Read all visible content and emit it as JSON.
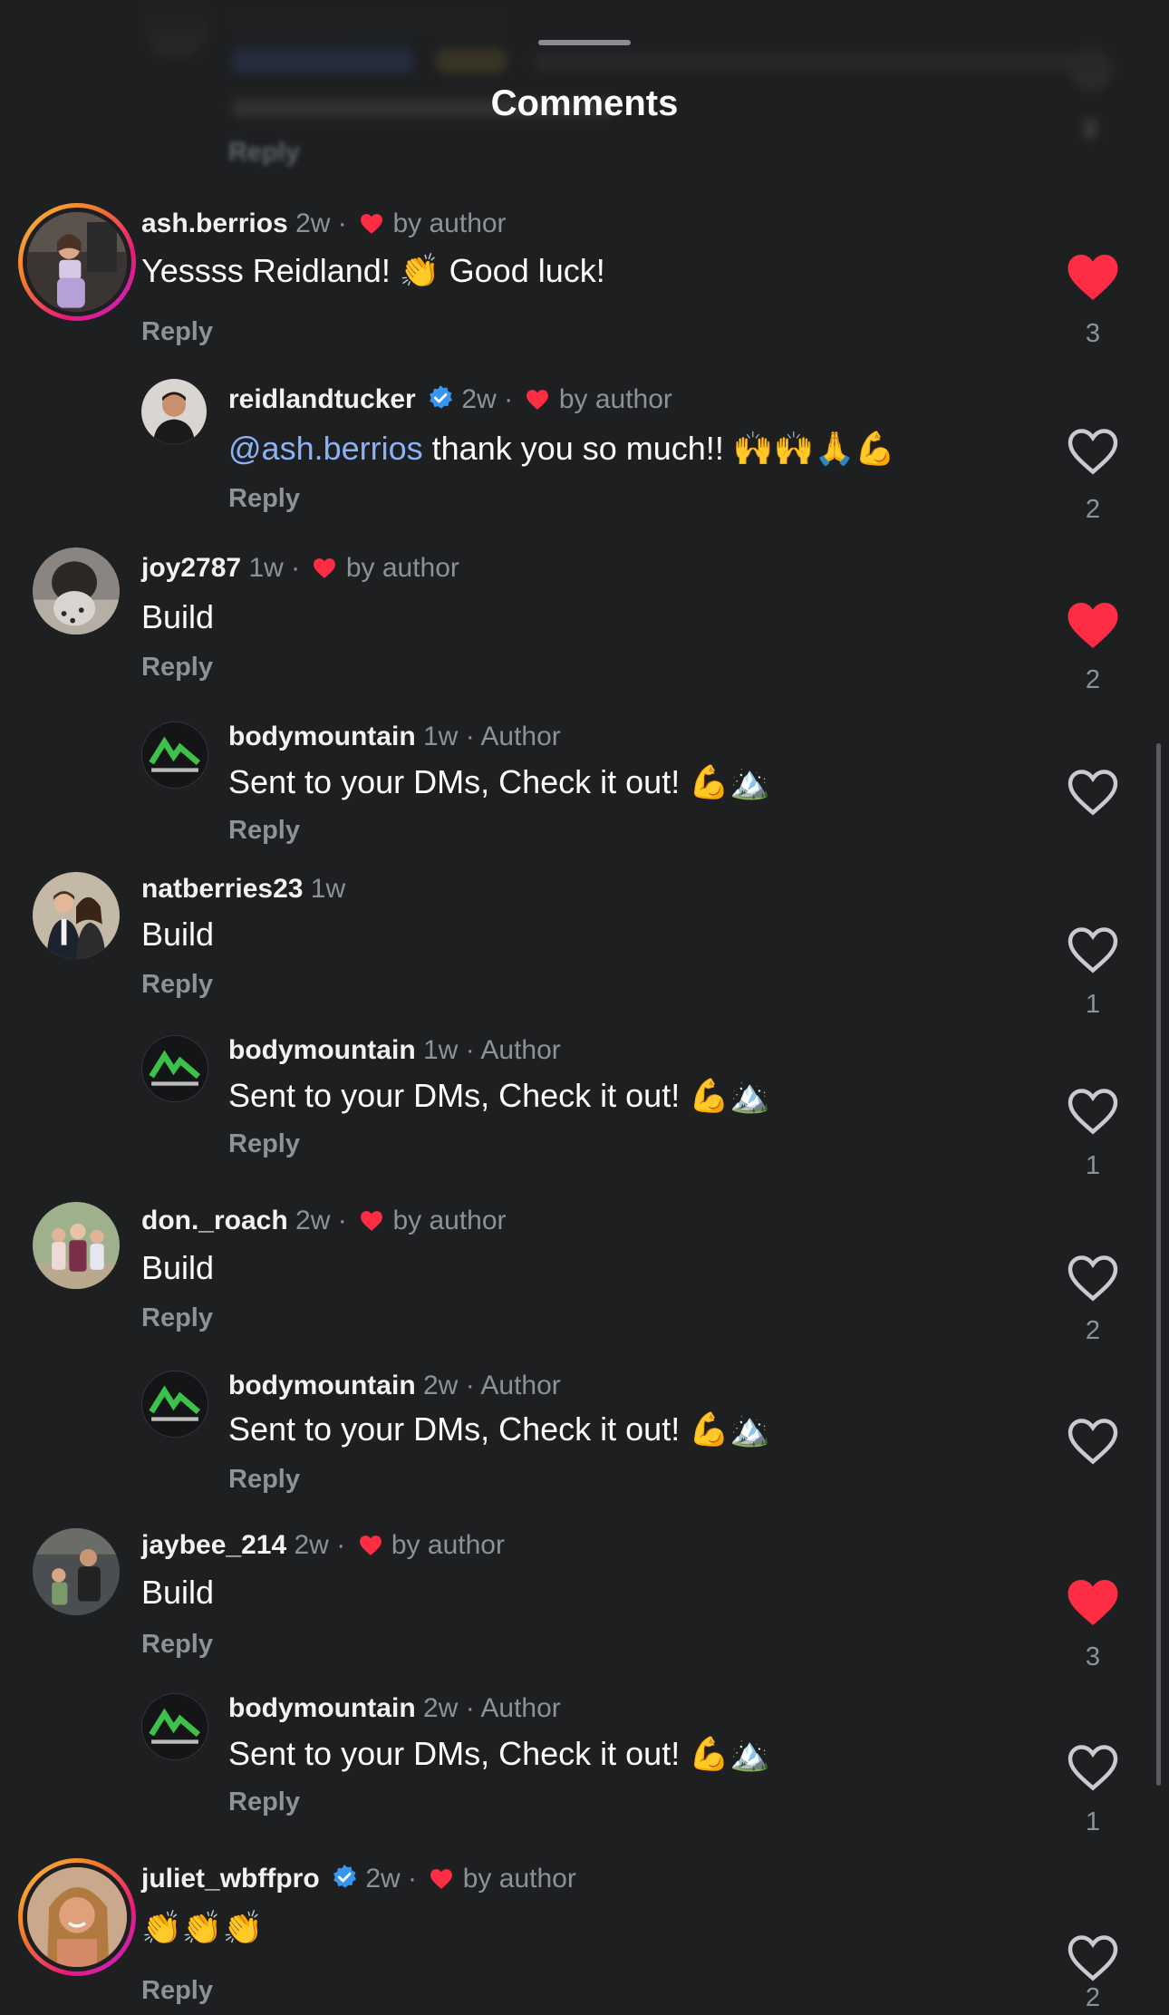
{
  "sheet": {
    "title": "Comments",
    "ghost_reply": "Reply"
  },
  "comments": [
    {
      "username": "ash.berrios",
      "time": "2w",
      "author_liked": true,
      "author_liked_label": "by author",
      "verified": false,
      "text": "Yessss Reidland! 👏 Good luck!",
      "reply_label": "Reply",
      "liked": true,
      "likes": "3",
      "reply": {
        "username": "reidlandtucker",
        "verified": true,
        "time": "2w",
        "author_liked_label": "by author",
        "mention": "@ash.berrios",
        "text": " thank you so much!! 🙌🙌🙏💪",
        "reply_label": "Reply",
        "liked": false,
        "likes": "2"
      }
    },
    {
      "username": "joy2787",
      "time": "1w",
      "author_liked_label": "by author",
      "text": "Build",
      "reply_label": "Reply",
      "liked": true,
      "likes": "2",
      "reply": {
        "username": "bodymountain",
        "time": "1w",
        "author_label": "Author",
        "text": "Sent to your DMs, Check it out! 💪🏔️",
        "reply_label": "Reply",
        "liked": false,
        "likes": ""
      }
    },
    {
      "username": "natberries23",
      "time": "1w",
      "text": "Build",
      "reply_label": "Reply",
      "liked": false,
      "likes": "1",
      "reply": {
        "username": "bodymountain",
        "time": "1w",
        "author_label": "Author",
        "text": "Sent to your DMs, Check it out! 💪🏔️",
        "reply_label": "Reply",
        "liked": false,
        "likes": "1"
      }
    },
    {
      "username": "don._roach",
      "time": "2w",
      "author_liked_label": "by author",
      "text": "Build",
      "reply_label": "Reply",
      "liked": false,
      "likes": "2",
      "reply": {
        "username": "bodymountain",
        "time": "2w",
        "author_label": "Author",
        "text": "Sent to your DMs, Check it out! 💪🏔️",
        "reply_label": "Reply",
        "liked": false,
        "likes": ""
      }
    },
    {
      "username": "jaybee_214",
      "time": "2w",
      "author_liked_label": "by author",
      "text": "Build",
      "reply_label": "Reply",
      "liked": true,
      "likes": "3",
      "reply": {
        "username": "bodymountain",
        "time": "2w",
        "author_label": "Author",
        "text": "Sent to your DMs, Check it out! 💪🏔️",
        "reply_label": "Reply",
        "liked": false,
        "likes": "1"
      }
    },
    {
      "username": "juliet_wbffpro",
      "verified": true,
      "time": "2w",
      "author_liked_label": "by author",
      "text": "👏👏👏",
      "reply_label": "Reply",
      "liked": false,
      "likes": "2"
    }
  ],
  "colors": {
    "background": "#1d1f21",
    "heart_red": "#ff2d44",
    "verified_blue": "#3797f0",
    "mention_blue": "#8bb2f4",
    "muted_text": "#8e9196",
    "logo_green": "#3cc24a"
  },
  "icons": {
    "like": "heart-icon",
    "verified": "verified-badge-icon",
    "author_like": "small-heart-icon",
    "logo": "body-mountain-logo-icon"
  }
}
